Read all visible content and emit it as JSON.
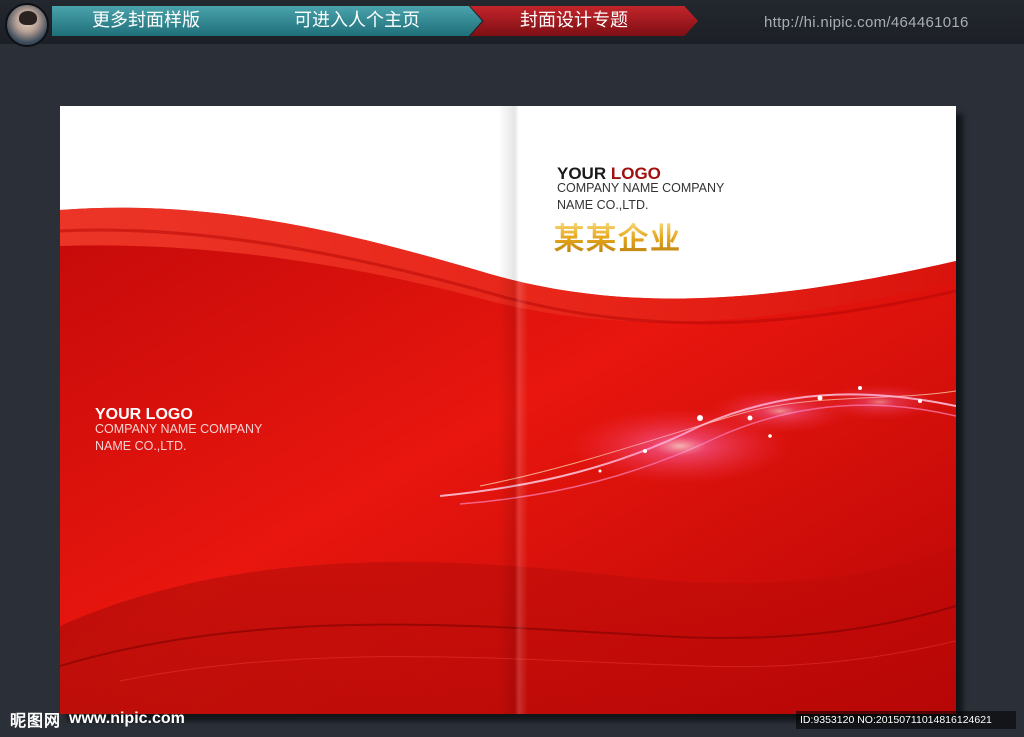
{
  "nav": {
    "items": [
      {
        "label": "更多封面样版"
      },
      {
        "label": "可进入人个主页"
      },
      {
        "label": "封面设计专题"
      }
    ],
    "url": "http://hi.nipic.com/464461016"
  },
  "cover": {
    "front": {
      "logo_main": "YOUR ",
      "logo_accent": "LOGO",
      "company_line1": "COMPANY NAME COMPANY",
      "company_line2": "NAME CO.,LTD.",
      "company_cn": "某某企业"
    },
    "back": {
      "logo": "YOUR LOGO",
      "company_line1": "COMPANY NAME COMPANY",
      "company_line2": "NAME CO.,LTD."
    }
  },
  "watermark": {
    "site_cn": "昵图网",
    "site_url": "www.nipic.com",
    "id_text": "ID:9353120 NO:20150711014816124621"
  },
  "colors": {
    "red_main": "#d81010",
    "red_dark": "#9e0808",
    "nav_teal": "#2f8792",
    "nav_red": "#b51d22",
    "gold": "#e5a51b"
  }
}
